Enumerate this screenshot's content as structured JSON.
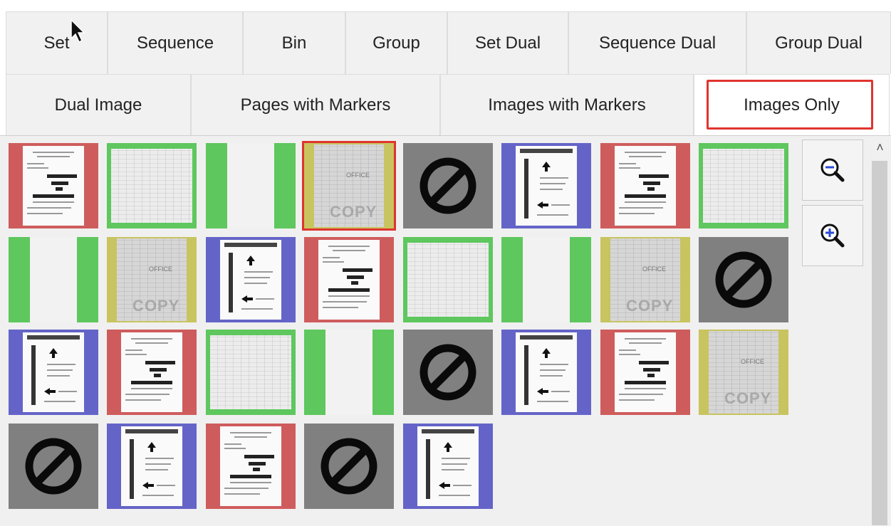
{
  "tabs_row1": [
    {
      "label": "Set"
    },
    {
      "label": "Sequence"
    },
    {
      "label": "Bin"
    },
    {
      "label": "Group"
    },
    {
      "label": "Set Dual"
    },
    {
      "label": "Sequence Dual"
    },
    {
      "label": "Group Dual"
    }
  ],
  "tabs_row2": [
    {
      "label": "Dual Image"
    },
    {
      "label": "Pages with Markers"
    },
    {
      "label": "Images with Markers"
    },
    {
      "label": "Images Only"
    }
  ],
  "active_tab": "Images Only",
  "colors": {
    "red": "#cf5c5c",
    "green": "#5ec75e",
    "blue": "#6464c8",
    "yellow": "#c8c460",
    "gray": "#808080",
    "highlight": "#e0342f"
  },
  "thumbnails": [
    {
      "frame": "red",
      "kind": "text-doc"
    },
    {
      "frame": "green",
      "kind": "scan-grid"
    },
    {
      "frame": "green",
      "kind": "blank"
    },
    {
      "frame": "yellow",
      "kind": "copy-scan",
      "selected": true,
      "stamp": "OFFICE",
      "watermark": "COPY"
    },
    {
      "frame": "gray",
      "kind": "no-image"
    },
    {
      "frame": "blue",
      "kind": "form"
    },
    {
      "frame": "red",
      "kind": "text-doc"
    },
    {
      "frame": "green",
      "kind": "scan-grid"
    },
    {
      "frame": "green",
      "kind": "blank"
    },
    {
      "frame": "yellow",
      "kind": "copy-scan",
      "stamp": "OFFICE",
      "watermark": "COPY"
    },
    {
      "frame": "blue",
      "kind": "form"
    },
    {
      "frame": "red",
      "kind": "text-doc"
    },
    {
      "frame": "green",
      "kind": "scan-grid"
    },
    {
      "frame": "green",
      "kind": "blank"
    },
    {
      "frame": "yellow",
      "kind": "copy-scan",
      "stamp": "OFFICE",
      "watermark": "COPY"
    },
    {
      "frame": "gray",
      "kind": "no-image"
    },
    {
      "frame": "blue",
      "kind": "form"
    },
    {
      "frame": "red",
      "kind": "text-doc"
    },
    {
      "frame": "green",
      "kind": "scan-grid"
    },
    {
      "frame": "green",
      "kind": "blank"
    },
    {
      "frame": "gray",
      "kind": "no-image"
    },
    {
      "frame": "blue",
      "kind": "form"
    },
    {
      "frame": "red",
      "kind": "text-doc"
    },
    {
      "frame": "yellow",
      "kind": "copy-scan",
      "stamp": "OFFICE",
      "watermark": "COPY"
    },
    {
      "frame": "gray",
      "kind": "no-image"
    },
    {
      "frame": "blue",
      "kind": "form"
    },
    {
      "frame": "red",
      "kind": "text-doc"
    },
    {
      "frame": "gray",
      "kind": "no-image"
    },
    {
      "frame": "blue",
      "kind": "form"
    }
  ],
  "icons": {
    "zoom_out": "zoom-out-icon",
    "zoom_in": "zoom-in-icon",
    "scroll_up": "chevron-up-icon",
    "no_image": "no-image-icon",
    "cursor": "mouse-cursor-icon"
  },
  "scroll_up_glyph": "˄"
}
